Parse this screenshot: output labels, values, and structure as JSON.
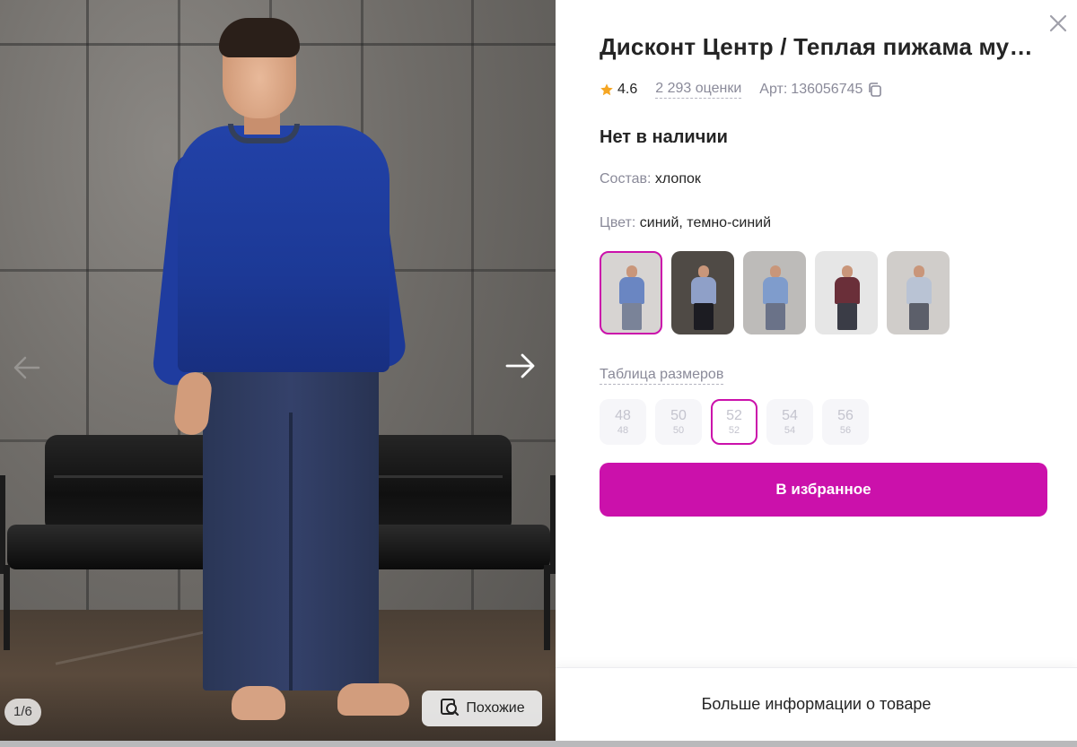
{
  "product": {
    "title": "Дисконт Центр / Теплая пижама мужская",
    "rating": "4.6",
    "reviews": "2 293 оценки",
    "article_label": "Арт:",
    "article": "136056745",
    "stock_status": "Нет в наличии",
    "composition_label": "Состав:",
    "composition": "хлопок",
    "color_label": "Цвет:",
    "color": "синий, темно-синий"
  },
  "gallery": {
    "counter": "1/6",
    "similar_label": "Похожие"
  },
  "swatches": [
    {
      "top": "#6a86c2",
      "legs": "#7a8398",
      "bg": "#d7d4d2",
      "active": true
    },
    {
      "top": "#8fa0c8",
      "legs": "#1c1c22",
      "bg": "#4f4a45",
      "active": false
    },
    {
      "top": "#7f9ccc",
      "legs": "#6a7288",
      "bg": "#bdbbb9",
      "active": false
    },
    {
      "top": "#6a2f39",
      "legs": "#3a3c46",
      "bg": "#e6e6e6",
      "active": false
    },
    {
      "top": "#b9c3d4",
      "legs": "#5c5f6a",
      "bg": "#d0cdca",
      "active": false
    }
  ],
  "size_table_label": "Таблица размеров",
  "sizes": [
    {
      "label": "48",
      "sub": "48",
      "active": false
    },
    {
      "label": "50",
      "sub": "50",
      "active": false
    },
    {
      "label": "52",
      "sub": "52",
      "active": true
    },
    {
      "label": "54",
      "sub": "54",
      "active": false
    },
    {
      "label": "56",
      "sub": "56",
      "active": false
    }
  ],
  "favorite_button": "В избранное",
  "more_info": "Больше информации о товаре",
  "colors": {
    "accent": "#cb11ab",
    "star": "#f5a623",
    "muted": "#8a8a99"
  },
  "icons": [
    "close-icon",
    "star-icon",
    "copy-icon",
    "arrow-left-icon",
    "arrow-right-icon",
    "similar-search-icon"
  ]
}
